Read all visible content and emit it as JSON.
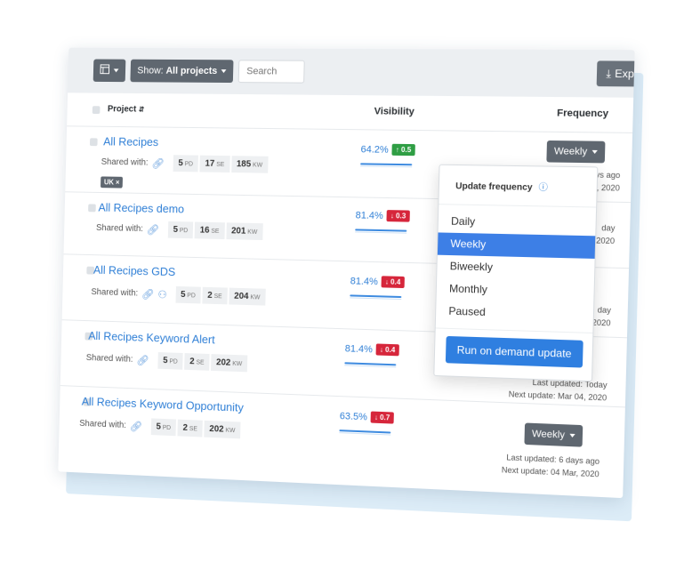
{
  "toolbar": {
    "show_prefix": "Show:",
    "show_value": "All projects",
    "search_placeholder": "Search",
    "export_label": "Exp"
  },
  "table": {
    "col_project": "Project",
    "col_visibility": "Visibility",
    "col_frequency": "Frequency"
  },
  "rows": [
    {
      "name": "All Recipes",
      "shared_label": "Shared with:",
      "tags": [
        {
          "v": "5",
          "u": "PD"
        },
        {
          "v": "17",
          "u": "SE"
        },
        {
          "v": "185",
          "u": "KW"
        }
      ],
      "badge": "UK ×",
      "visibility": "64.2%",
      "delta": "↑ 0.5",
      "delta_dir": "up",
      "frequency": "Weekly",
      "last_updated": "ys ago",
      "next_update": "4, 2020"
    },
    {
      "name": "All Recipes demo",
      "shared_label": "Shared with:",
      "tags": [
        {
          "v": "5",
          "u": "PD"
        },
        {
          "v": "16",
          "u": "SE"
        },
        {
          "v": "201",
          "u": "KW"
        }
      ],
      "visibility": "81.4%",
      "delta": "↓ 0.3",
      "delta_dir": "down",
      "last_updated": "day",
      "next_update": "4, 2020"
    },
    {
      "name": "All Recipes GDS",
      "shared_label": "Shared with:",
      "tags": [
        {
          "v": "5",
          "u": "PD"
        },
        {
          "v": "2",
          "u": "SE"
        },
        {
          "v": "204",
          "u": "KW"
        }
      ],
      "visibility": "81.4%",
      "delta": "↓ 0.4",
      "delta_dir": "down",
      "last_updated": "day",
      "next_update": "4, 2020"
    },
    {
      "name": "All Recipes Keyword Alert",
      "shared_label": "Shared with:",
      "tags": [
        {
          "v": "5",
          "u": "PD"
        },
        {
          "v": "2",
          "u": "SE"
        },
        {
          "v": "202",
          "u": "KW"
        }
      ],
      "visibility": "81.4%",
      "delta": "↓ 0.4",
      "delta_dir": "down",
      "last_updated": "Last updated: Today",
      "next_update": "Next update: Mar 04, 2020"
    },
    {
      "name": "All Recipes Keyword Opportunity",
      "shared_label": "Shared with:",
      "tags": [
        {
          "v": "5",
          "u": "PD"
        },
        {
          "v": "2",
          "u": "SE"
        },
        {
          "v": "202",
          "u": "KW"
        }
      ],
      "visibility": "63.5%",
      "delta": "↓ 0.7",
      "delta_dir": "down",
      "frequency": "Weekly",
      "last_updated": "Last updated: 6 days ago",
      "next_update": "Next update: 04 Mar, 2020"
    }
  ],
  "dropdown": {
    "title": "Update frequency",
    "options": [
      "Daily",
      "Weekly",
      "Biweekly",
      "Monthly",
      "Paused"
    ],
    "selected": "Weekly",
    "run_label": "Run on demand update"
  },
  "colors": {
    "accent": "#3d7fe6",
    "link": "#2f7fd6",
    "up": "#2f9e44",
    "down": "#d6263b",
    "dark_button": "#5f6770"
  }
}
